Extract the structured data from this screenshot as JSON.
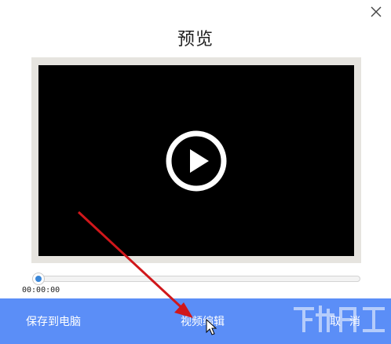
{
  "dialog": {
    "title": "预览",
    "close_icon": "close-icon"
  },
  "player": {
    "play_icon": "play-icon",
    "time": "00:00:00",
    "progress": 0
  },
  "actions": {
    "save_label": "保存到电脑",
    "edit_label": "视频编辑",
    "cancel_label": "取消"
  },
  "colors": {
    "bottom_bar": "#5b8ef7",
    "video_bg": "#000000",
    "frame": "#e6e4df",
    "knob": "#3a86d8",
    "annotation_arrow": "#d0171b"
  }
}
